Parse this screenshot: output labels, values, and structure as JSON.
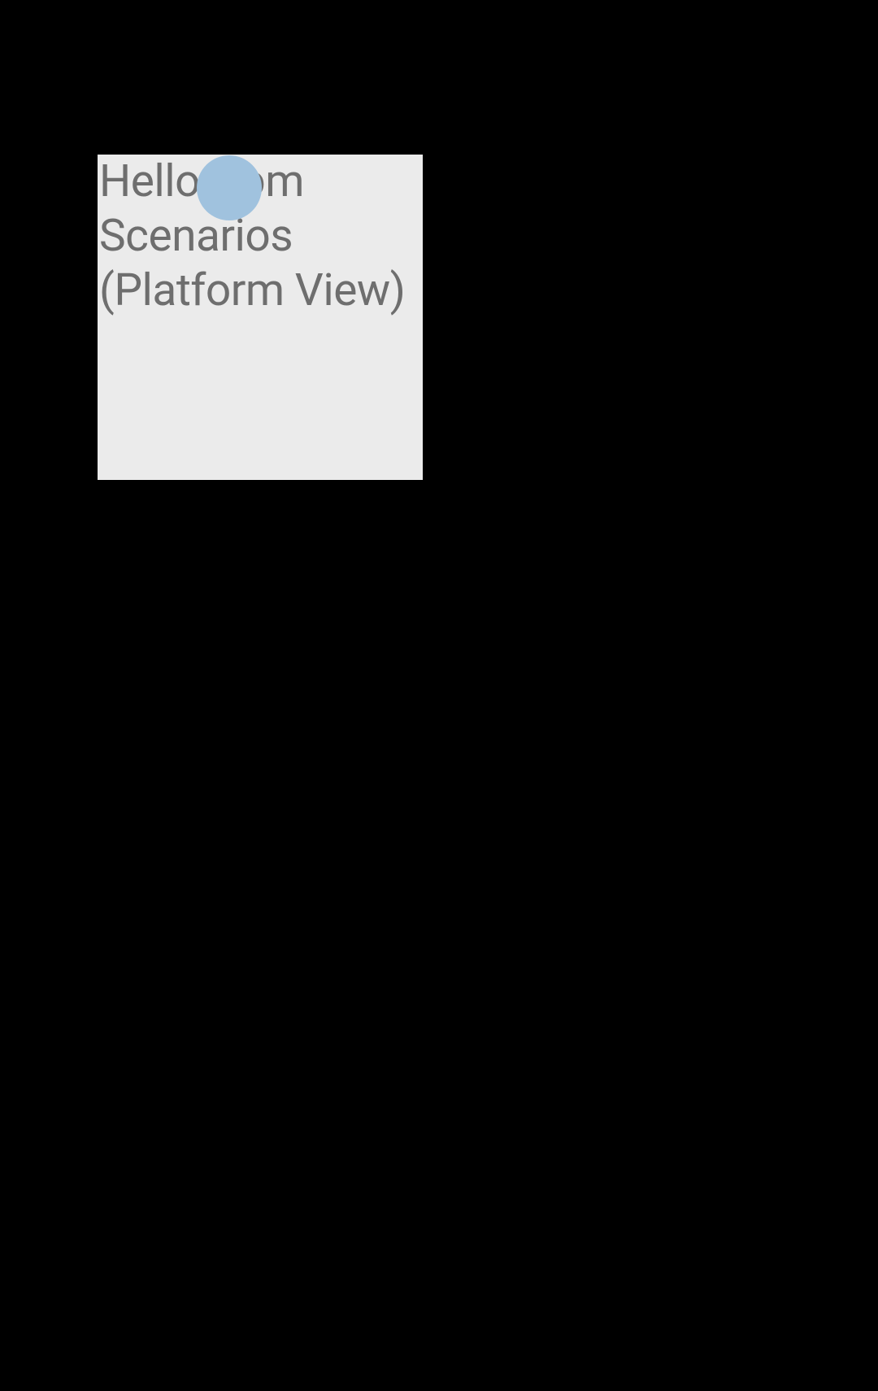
{
  "panel": {
    "text": "Hello from Scenarios (Platform View)"
  },
  "colors": {
    "background": "#000000",
    "panel_bg": "#EBEBEB",
    "text": "#6E6E6E",
    "circle": "#A0C2DE"
  }
}
